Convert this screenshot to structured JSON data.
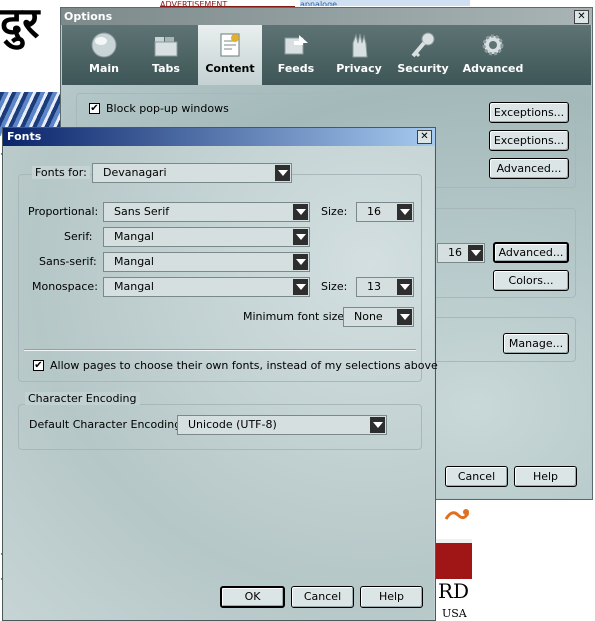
{
  "background_page": {
    "glyph_text": "दुर",
    "top_ad_text": "ADVERTISEMENT",
    "top_logo_text": "apnaloge",
    "bottom_text_rd": "RD",
    "bottom_text_usa": "USA"
  },
  "options_window": {
    "title": "Options",
    "close_glyph": "✕",
    "toolbar": [
      {
        "label": "Main",
        "icon": "main-icon"
      },
      {
        "label": "Tabs",
        "icon": "tabs-icon"
      },
      {
        "label": "Content",
        "icon": "content-icon",
        "selected": true
      },
      {
        "label": "Feeds",
        "icon": "feeds-icon"
      },
      {
        "label": "Privacy",
        "icon": "privacy-icon"
      },
      {
        "label": "Security",
        "icon": "security-icon"
      },
      {
        "label": "Advanced",
        "icon": "advanced-icon"
      }
    ],
    "block_popups_label": "Block pop-up windows",
    "block_popups_checked": true,
    "exceptions_label": "Exceptions...",
    "advanced_label": "Advanced...",
    "size_value": "16",
    "colors_label": "Colors...",
    "manage_label": "Manage...",
    "cancel_label": "Cancel",
    "help_label": "Help"
  },
  "fonts_dialog": {
    "title": "Fonts",
    "close_glyph": "✕",
    "fonts_for_label": "Fonts for:",
    "fonts_for_value": "Devanagari",
    "proportional_label": "Proportional:",
    "proportional_value": "Sans Serif",
    "size_label": "Size:",
    "proportional_size": "16",
    "serif_label": "Serif:",
    "serif_value": "Mangal",
    "sans_serif_label": "Sans-serif:",
    "sans_serif_value": "Mangal",
    "monospace_label": "Monospace:",
    "monospace_value": "Mangal",
    "monospace_size": "13",
    "min_font_size_label": "Minimum font size:",
    "min_font_size_value": "None",
    "allow_pages_label": "Allow pages to choose their own fonts, instead of my selections above",
    "allow_pages_checked": true,
    "char_encoding_group": "Character Encoding",
    "default_encoding_label": "Default Character Encoding:",
    "default_encoding_value": "Unicode (UTF-8)",
    "ok_label": "OK",
    "cancel_label": "Cancel",
    "help_label": "Help"
  },
  "colors": {
    "fonts_titlebar": "#0a246a",
    "options_titlebar": "#7d8a8b",
    "toolbar": "#4a6263",
    "dialog_bg": "#c3d1d2"
  }
}
